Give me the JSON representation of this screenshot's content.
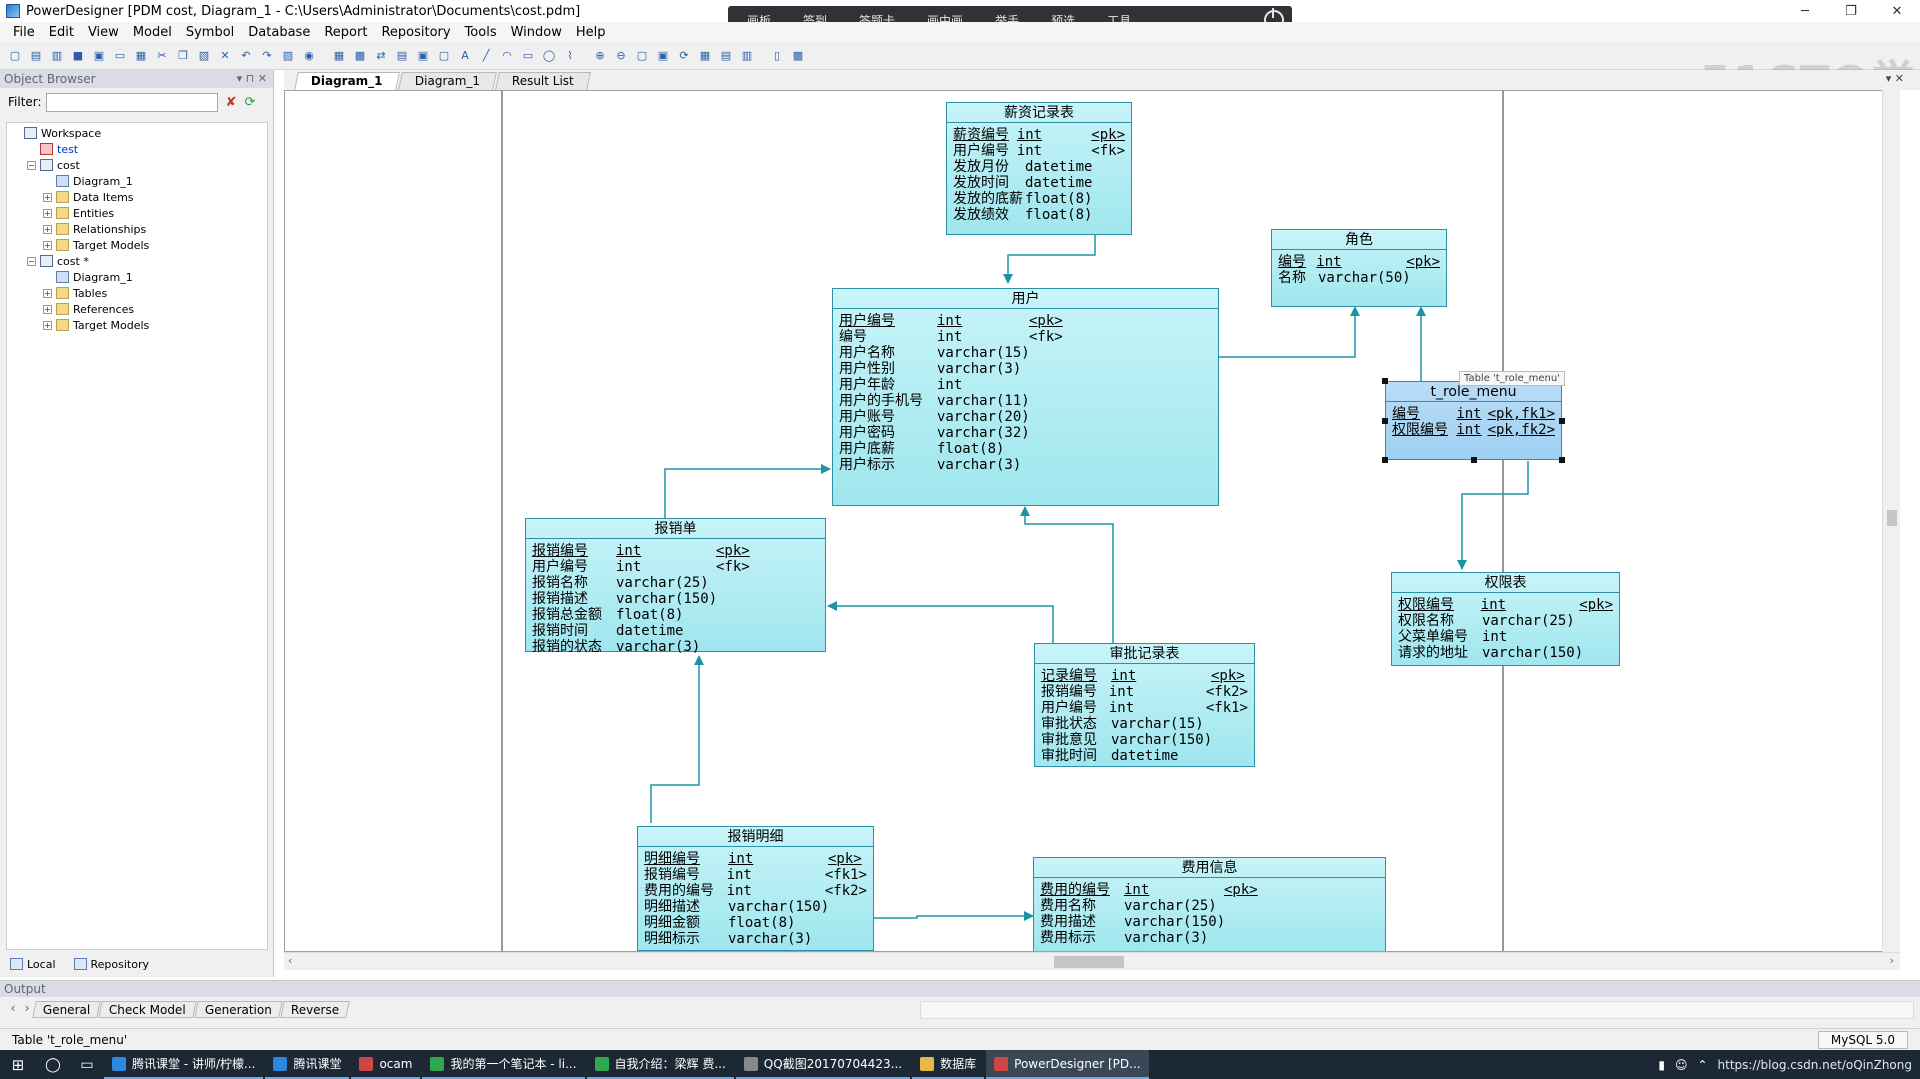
{
  "window": {
    "title": "PowerDesigner [PDM cost, Diagram_1 - C:\\Users\\Administrator\\Documents\\cost.pdm]",
    "minimize": "─",
    "restore": "❐",
    "close": "✕"
  },
  "meeting_bar": {
    "items": [
      "画板",
      "签到",
      "答题卡",
      "画中画",
      "举手",
      "预选",
      "工具"
    ]
  },
  "menu": [
    "File",
    "Edit",
    "View",
    "Model",
    "Symbol",
    "Database",
    "Report",
    "Repository",
    "Tools",
    "Window",
    "Help"
  ],
  "watermark": "51CTO学院",
  "object_browser": {
    "title": "Object Browser",
    "filter_label": "Filter:",
    "filter_value": "",
    "tree": [
      {
        "label": "Workspace",
        "level": 0,
        "toggle": "",
        "icon": "ws"
      },
      {
        "label": "test",
        "level": 1,
        "toggle": "",
        "icon": "test",
        "blue": true
      },
      {
        "label": "cost",
        "level": 1,
        "toggle": "−",
        "icon": "ws"
      },
      {
        "label": "Diagram_1",
        "level": 2,
        "toggle": "",
        "icon": "diagram"
      },
      {
        "label": "Data Items",
        "level": 2,
        "toggle": "+",
        "icon": "folder"
      },
      {
        "label": "Entities",
        "level": 2,
        "toggle": "+",
        "icon": "folder"
      },
      {
        "label": "Relationships",
        "level": 2,
        "toggle": "+",
        "icon": "folder"
      },
      {
        "label": "Target Models",
        "level": 2,
        "toggle": "+",
        "icon": "folder"
      },
      {
        "label": "cost *",
        "level": 1,
        "toggle": "−",
        "icon": "ws"
      },
      {
        "label": "Diagram_1",
        "level": 2,
        "toggle": "",
        "icon": "diagram"
      },
      {
        "label": "Tables",
        "level": 2,
        "toggle": "+",
        "icon": "folder"
      },
      {
        "label": "References",
        "level": 2,
        "toggle": "+",
        "icon": "folder"
      },
      {
        "label": "Target Models",
        "level": 2,
        "toggle": "+",
        "icon": "folder"
      }
    ],
    "tabs": [
      "Local",
      "Repository"
    ]
  },
  "doc_tabs": [
    "Diagram_1",
    "Diagram_1",
    "Result List"
  ],
  "entities": [
    {
      "id": "salary",
      "title": "薪资记录表",
      "rows": [
        [
          "薪资编号",
          "int",
          "<pk>"
        ],
        [
          "用户编号",
          "int",
          "<fk>"
        ],
        [
          "发放月份",
          "datetime",
          ""
        ],
        [
          "发放时间",
          "datetime",
          ""
        ],
        [
          "发放的底薪",
          "float(8)",
          ""
        ],
        [
          "发放绩效",
          "float(8)",
          ""
        ]
      ]
    },
    {
      "id": "role",
      "title": "角色",
      "rows": [
        [
          "编号",
          "int",
          "<pk>"
        ],
        [
          "名称",
          "varchar(50)",
          ""
        ]
      ]
    },
    {
      "id": "user",
      "title": "用户",
      "rows": [
        [
          "用户编号",
          "int",
          "<pk>"
        ],
        [
          "编号",
          "int",
          "<fk>"
        ],
        [
          "用户名称",
          "varchar(15)",
          ""
        ],
        [
          "用户性别",
          "varchar(3)",
          ""
        ],
        [
          "用户年龄",
          "int",
          ""
        ],
        [
          "用户的手机号",
          "varchar(11)",
          ""
        ],
        [
          "用户账号",
          "varchar(20)",
          ""
        ],
        [
          "用户密码",
          "varchar(32)",
          ""
        ],
        [
          "用户底薪",
          "float(8)",
          ""
        ],
        [
          "用户标示",
          "varchar(3)",
          ""
        ]
      ]
    },
    {
      "id": "role_menu",
      "title": "t_role_menu",
      "rows": [
        [
          "编号",
          "int",
          "<pk,fk1>"
        ],
        [
          "权限编号",
          "int",
          "<pk,fk2>"
        ]
      ]
    },
    {
      "id": "expense",
      "title": "报销单",
      "rows": [
        [
          "报销编号",
          "int",
          "<pk>"
        ],
        [
          "用户编号",
          "int",
          "<fk>"
        ],
        [
          "报销名称",
          "varchar(25)",
          ""
        ],
        [
          "报销描述",
          "varchar(150)",
          ""
        ],
        [
          "报销总金额",
          "float(8)",
          ""
        ],
        [
          "报销时间",
          "datetime",
          ""
        ],
        [
          "报销的状态",
          "varchar(3)",
          ""
        ]
      ]
    },
    {
      "id": "permission",
      "title": "权限表",
      "rows": [
        [
          "权限编号",
          "int",
          "<pk>"
        ],
        [
          "权限名称",
          "varchar(25)",
          ""
        ],
        [
          "父菜单编号",
          "int",
          ""
        ],
        [
          "请求的地址",
          "varchar(150)",
          ""
        ]
      ]
    },
    {
      "id": "approval",
      "title": "审批记录表",
      "rows": [
        [
          "记录编号",
          "int",
          "<pk>"
        ],
        [
          "报销编号",
          "int",
          "<fk2>"
        ],
        [
          "用户编号",
          "int",
          "<fk1>"
        ],
        [
          "审批状态",
          "varchar(15)",
          ""
        ],
        [
          "审批意见",
          "varchar(150)",
          ""
        ],
        [
          "审批时间",
          "datetime",
          ""
        ]
      ]
    },
    {
      "id": "expense_detail",
      "title": "报销明细",
      "rows": [
        [
          "明细编号",
          "int",
          "<pk>"
        ],
        [
          "报销编号",
          "int",
          "<fk1>"
        ],
        [
          "费用的编号",
          "int",
          "<fk2>"
        ],
        [
          "明细描述",
          "varchar(150)",
          ""
        ],
        [
          "明细金额",
          "float(8)",
          ""
        ],
        [
          "明细标示",
          "varchar(3)",
          ""
        ]
      ]
    },
    {
      "id": "fee",
      "title": "费用信息",
      "rows": [
        [
          "费用的编号",
          "int",
          "<pk>"
        ],
        [
          "费用名称",
          "varchar(25)",
          ""
        ],
        [
          "费用描述",
          "varchar(150)",
          ""
        ],
        [
          "费用标示",
          "varchar(3)",
          ""
        ]
      ]
    }
  ],
  "tooltip_tag": "Table 't_role_menu'",
  "output": {
    "title": "Output",
    "tabs": [
      "General",
      "Check Model",
      "Generation",
      "Reverse"
    ]
  },
  "status": {
    "text": "Table 't_role_menu'",
    "dbms": "MySQL 5.0"
  },
  "taskbar": {
    "tasks": [
      {
        "label": "腾讯课堂 - 讲师/柠檬...",
        "color": "#2b8ae0"
      },
      {
        "label": "腾讯课堂",
        "color": "#2b8ae0"
      },
      {
        "label": "ocam",
        "color": "#d04545"
      },
      {
        "label": "我的第一个笔记本 - li...",
        "color": "#2fa84f"
      },
      {
        "label": "自我介绍：梁辉 费...",
        "color": "#2fa84f"
      },
      {
        "label": "QQ截图20170704423...",
        "color": "#888888"
      },
      {
        "label": "数据库",
        "color": "#e6b84a"
      },
      {
        "label": "PowerDesigner [PD...",
        "color": "#d04545"
      }
    ],
    "tray_text": "https://blog.csdn.net/oQinZhong"
  },
  "colors": {
    "entity_fill": "#aeecf3",
    "entity_border": "#2f8fa6",
    "link": "#1b95a6",
    "taskbar": "#1d2835"
  }
}
